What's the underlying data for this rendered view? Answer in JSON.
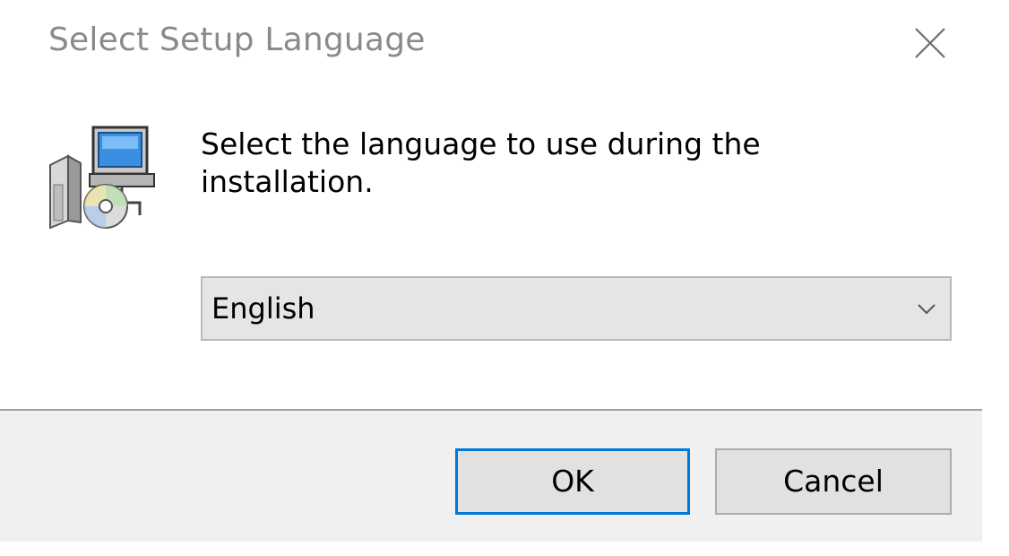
{
  "window": {
    "title": "Select Setup Language",
    "close_icon": "close-icon"
  },
  "content": {
    "icon": "setup-installer-icon",
    "message": "Select the language to use during the installation."
  },
  "language_select": {
    "selected": "English",
    "dropdown_icon": "chevron-down-icon"
  },
  "buttons": {
    "ok_label": "OK",
    "cancel_label": "Cancel"
  },
  "colors": {
    "focus_border": "#0078d7",
    "footer_bg": "#f0f0f0",
    "title_text": "#8a8a8a"
  }
}
